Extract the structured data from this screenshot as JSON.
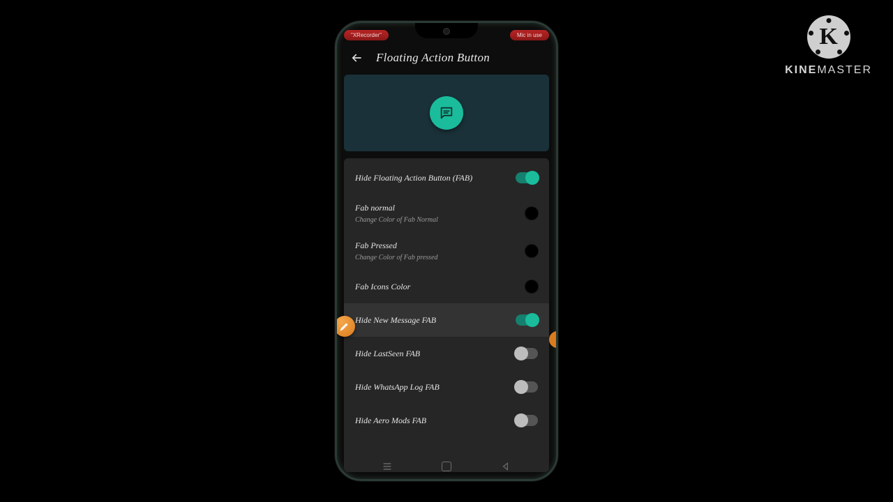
{
  "watermark": {
    "brand_bold": "KINE",
    "brand_light": "MASTER"
  },
  "status": {
    "left_pill": "\"XRecorder\"",
    "right_pill": "Mic in use"
  },
  "header": {
    "title": "Floating Action Button"
  },
  "settings": [
    {
      "title": "Hide Floating Action Button (FAB)",
      "sub": "",
      "control": "switch",
      "on": true,
      "highlight": false
    },
    {
      "title": "Fab normal",
      "sub": "Change Color of Fab Normal",
      "control": "color",
      "on": false,
      "highlight": false
    },
    {
      "title": "Fab Pressed",
      "sub": "Change Color of Fab pressed",
      "control": "color",
      "on": false,
      "highlight": false
    },
    {
      "title": "Fab Icons Color",
      "sub": "",
      "control": "color",
      "on": false,
      "highlight": false
    },
    {
      "title": "Hide New Message FAB",
      "sub": "",
      "control": "switch",
      "on": true,
      "highlight": true
    },
    {
      "title": "Hide LastSeen FAB",
      "sub": "",
      "control": "switch",
      "on": false,
      "highlight": false
    },
    {
      "title": "Hide WhatsApp Log FAB",
      "sub": "",
      "control": "switch",
      "on": false,
      "highlight": false
    },
    {
      "title": "Hide Aero Mods FAB",
      "sub": "",
      "control": "switch",
      "on": false,
      "highlight": false
    }
  ]
}
